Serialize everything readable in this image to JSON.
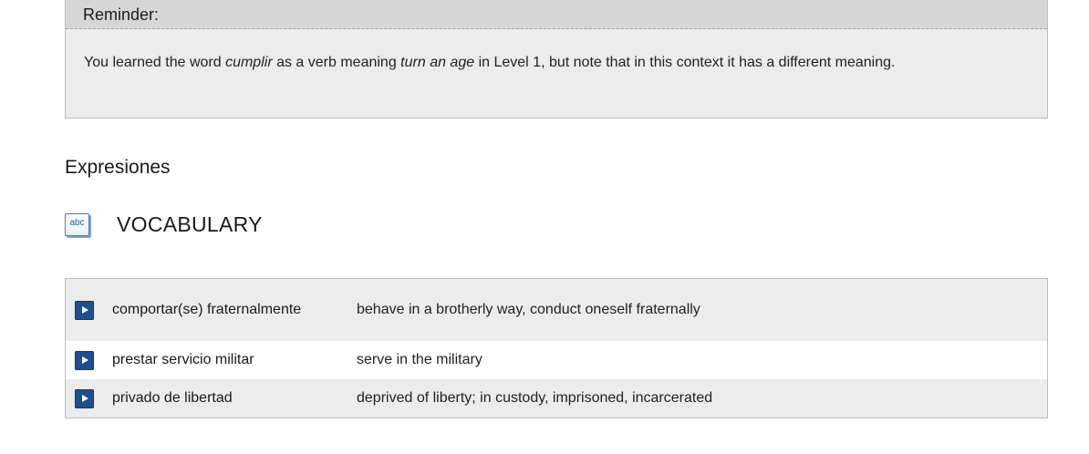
{
  "reminder": {
    "title": "Reminder:",
    "text_1": "You learned the word ",
    "word": "cumplir",
    "text_2": " as a verb meaning ",
    "meaning": "turn an age",
    "text_3": " in Level 1, but note that in this context it has a different meaning."
  },
  "section": {
    "title": "Expresiones"
  },
  "vocabulary": {
    "icon_text": "abc",
    "label": "VOCABULARY",
    "rows": [
      {
        "term": "comportar(se) fraternalmente",
        "definition": "behave in a brotherly way, conduct oneself fraternally"
      },
      {
        "term": "prestar servicio militar",
        "definition": "serve in the military"
      },
      {
        "term": "privado de libertad",
        "definition": "deprived of liberty; in custody, imprisoned, incarcerated"
      }
    ]
  },
  "colors": {
    "play_button": "#1f4e8c",
    "row_alt": "#ececec",
    "header": "#d6d6d6"
  }
}
